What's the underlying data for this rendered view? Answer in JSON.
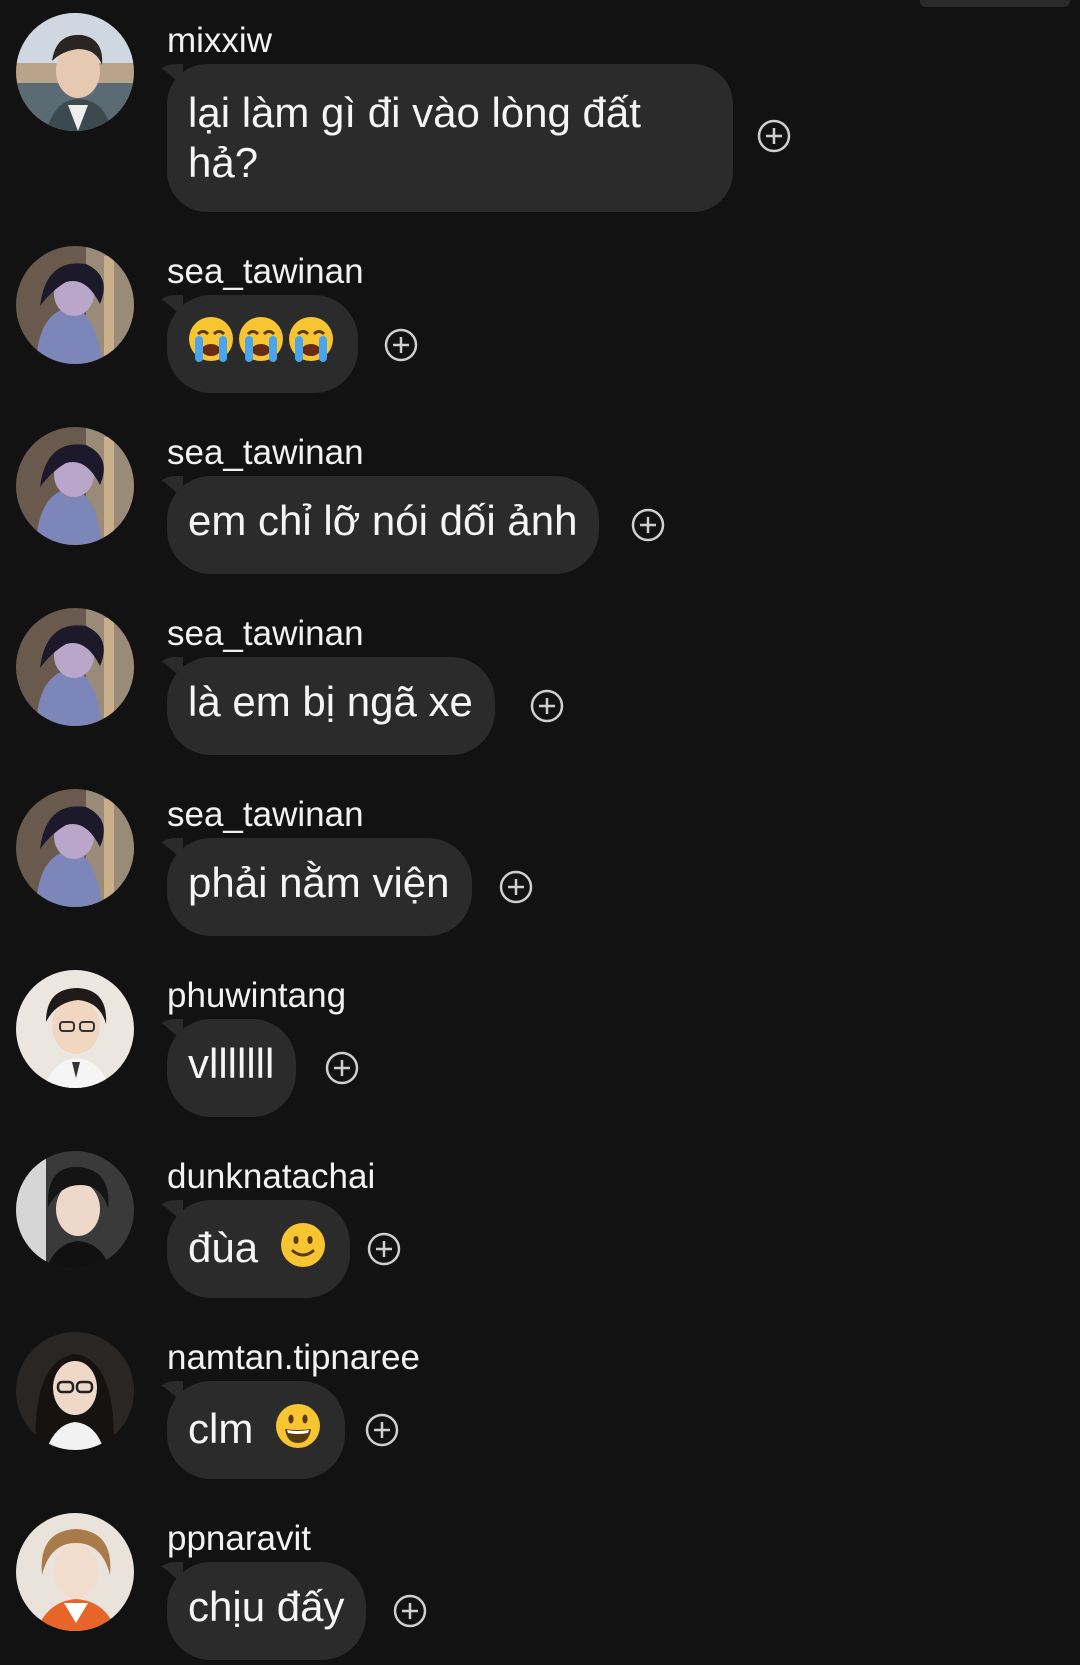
{
  "messages": [
    {
      "username": "mixxiw",
      "text": "lại làm gì đi vào lòng đất hả?",
      "emojis": []
    },
    {
      "username": "sea_tawinan",
      "text": "",
      "emojis": [
        "crying-emoji",
        "crying-emoji",
        "crying-emoji"
      ]
    },
    {
      "username": "sea_tawinan",
      "text": "em chỉ lỡ nói dối ảnh",
      "emojis": []
    },
    {
      "username": "sea_tawinan",
      "text": "là em bị ngã xe",
      "emojis": []
    },
    {
      "username": "sea_tawinan",
      "text": "phải nằm viện",
      "emojis": []
    },
    {
      "username": "phuwintang",
      "text": "vlllllll",
      "emojis": []
    },
    {
      "username": "dunknatachai",
      "text": "đùa",
      "emojis": [
        "slight-smile-emoji"
      ]
    },
    {
      "username": "namtan.tipnaree",
      "text": "clm",
      "emojis": [
        "grin-emoji"
      ]
    },
    {
      "username": "ppnaravit",
      "text": "chịu đấy",
      "emojis": []
    }
  ],
  "icons": {
    "react": "add-reaction-icon"
  },
  "colors": {
    "background": "#121212",
    "bubble": "#2b2b2b",
    "text": "#f2f2f2",
    "icon": "#cfcfcf"
  }
}
